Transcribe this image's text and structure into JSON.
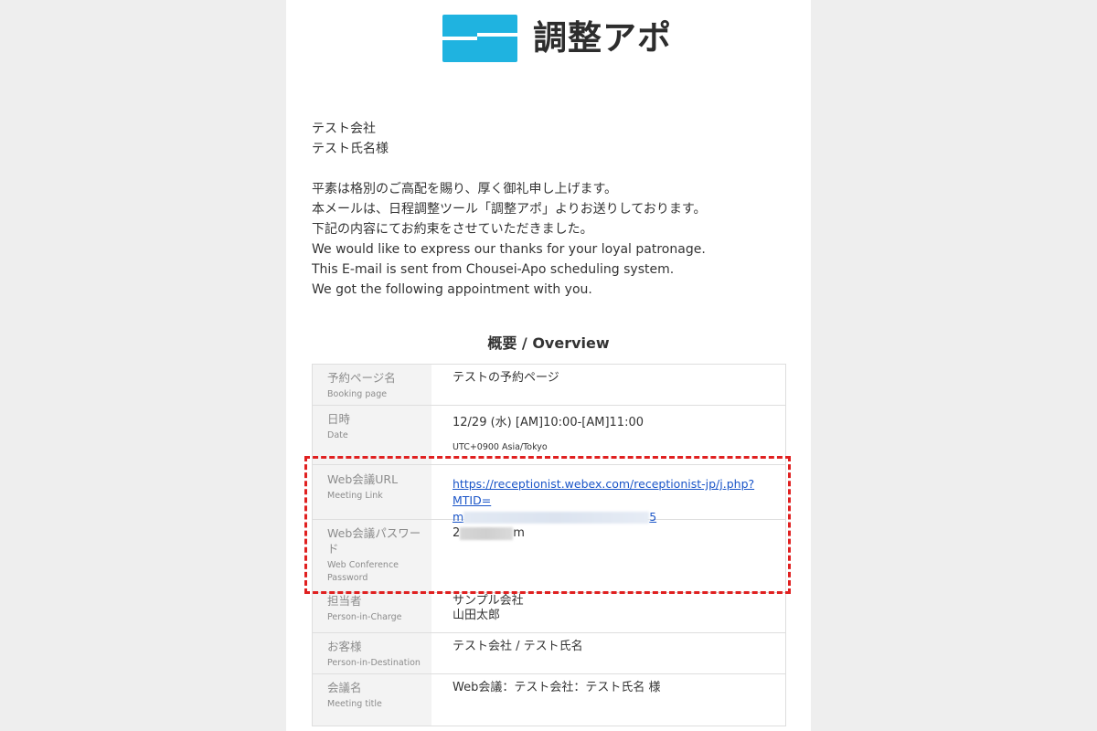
{
  "brand": {
    "name": "調整アポ",
    "accent": "#1fb3e0"
  },
  "intro": {
    "company": "テスト会社",
    "recipient": "テスト氏名様",
    "lines": [
      "平素は格別のご高配を賜り、厚く御礼申し上げます。",
      "本メールは、日程調整ツール「調整アポ」よりお送りしております。",
      "下記の内容にてお約束をさせていただきました。",
      "We would like to express our thanks for your loyal patronage.",
      "This E-mail is sent from Chousei-Apo scheduling system.",
      "We got the following appointment with you."
    ]
  },
  "overview": {
    "title": "概要 / Overview",
    "rows": {
      "booking": {
        "jp": "予約ページ名",
        "en": "Booking page",
        "value": "テストの予約ページ"
      },
      "date": {
        "jp": "日時",
        "en": "Date",
        "value": "12/29 (水) [AM]10:00-[AM]11:00",
        "tz": "UTC+0900 Asia/Tokyo"
      },
      "url": {
        "jp": "Web会議URL",
        "en": "Meeting Link",
        "line1": "https://receptionist.webex.com/receptionist-jp/j.php?MTID=",
        "line2_start": "m",
        "line2_end": "5"
      },
      "password": {
        "jp": "Web会議パスワード",
        "en": "Web Conference Password",
        "start": "2",
        "end": "m"
      },
      "person": {
        "jp": "担当者",
        "en": "Person-in-Charge",
        "company": "サンプル会社",
        "name": "山田太郎"
      },
      "customer": {
        "jp": "お客様",
        "en": "Person-in-Destination",
        "value": "テスト会社 / テスト氏名"
      },
      "meeting": {
        "jp": "会議名",
        "en": "Meeting title",
        "value": "Web会議：テスト会社：テスト氏名 様"
      }
    }
  },
  "highlight_color": "#e02020"
}
